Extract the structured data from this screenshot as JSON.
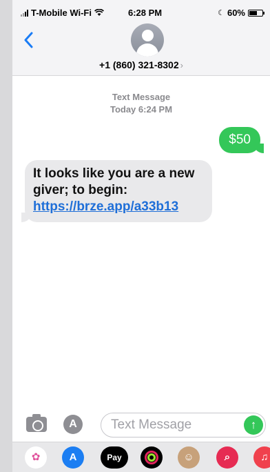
{
  "status_bar": {
    "carrier": "T-Mobile Wi-Fi",
    "time": "6:28 PM",
    "battery": "60%",
    "battery_level": 0.6
  },
  "header": {
    "contact": "+1 (860) 321-8302",
    "chevron": "›",
    "back_icon": "chevron-left-icon"
  },
  "thread": {
    "service": "Text Message",
    "timestamp": "Today 6:24 PM",
    "messages": [
      {
        "direction": "outgoing",
        "text": "$50"
      },
      {
        "direction": "incoming",
        "text": "It looks like you are a new giver; to begin: ",
        "link": "https://brze.app/a33b13"
      }
    ]
  },
  "composer": {
    "placeholder": "Text Message",
    "send_icon": "arrow-up-icon"
  },
  "app_drawer": {
    "apps": [
      "photos-icon",
      "app-store-icon",
      "apple-pay-icon",
      "activity-icon",
      "memoji-icon",
      "image-search-icon",
      "music-icon"
    ],
    "pay_label": "Pay"
  },
  "colors": {
    "accent": "#1a7cf5",
    "outgoing": "#34c759",
    "incoming": "#e9e9eb"
  }
}
